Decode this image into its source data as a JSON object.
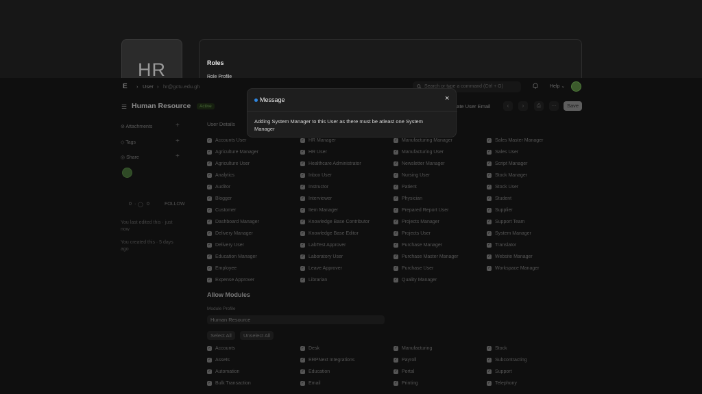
{
  "background_profile": {
    "initials": "HR",
    "section_title": "Roles",
    "section_sub": "Role Profile"
  },
  "topbar": {
    "logo": "E",
    "breadcrumb_user": "User",
    "breadcrumb_record": "hr@gctu.edu.gh",
    "search_placeholder": "Search or type a command (Ctrl + G)",
    "help": "Help"
  },
  "title_bar": {
    "title": "Human Resource",
    "status": "Active",
    "action_link": "eate User Email",
    "more": "···",
    "save": "Save"
  },
  "sidebar": {
    "attachments": "Attachments",
    "tags": "Tags",
    "share": "Share",
    "share_avatar": "HR",
    "likes": "0",
    "comments": "0",
    "follow": "FOLLOW",
    "last_edited": "You last edited this · just now",
    "created": "You created this · 5 days ago"
  },
  "main": {
    "user_details_label": "User Details",
    "roles": [
      [
        "Accounts User",
        "HR Manager",
        "Manufacturing Manager",
        "Sales Master Manager"
      ],
      [
        "Agriculture Manager",
        "HR User",
        "Manufacturing User",
        "Sales User"
      ],
      [
        "Agriculture User",
        "Healthcare Administrator",
        "Newsletter Manager",
        "Script Manager"
      ],
      [
        "Analytics",
        "Inbox User",
        "Nursing User",
        "Stock Manager"
      ],
      [
        "Auditor",
        "Instructor",
        "Patient",
        "Stock User"
      ],
      [
        "Blogger",
        "Interviewer",
        "Physician",
        "Student"
      ],
      [
        "Customer",
        "Item Manager",
        "Prepared Report User",
        "Supplier"
      ],
      [
        "Dashboard Manager",
        "Knowledge Base Contributor",
        "Projects Manager",
        "Support Team"
      ],
      [
        "Delivery Manager",
        "Knowledge Base Editor",
        "Projects User",
        "System Manager"
      ],
      [
        "Delivery User",
        "LabTest Approver",
        "Purchase Manager",
        "Translator"
      ],
      [
        "Education Manager",
        "Laboratory User",
        "Purchase Master Manager",
        "Website Manager"
      ],
      [
        "Employee",
        "Leave Approver",
        "Purchase User",
        "Workspace Manager"
      ],
      [
        "Expense Approver",
        "Librarian",
        "Quality Manager",
        ""
      ]
    ],
    "allow_modules_title": "Allow Modules",
    "module_profile_label": "Module Profile",
    "module_profile_value": "Human Resource",
    "select_all": "Select All",
    "unselect_all": "Unselect All",
    "modules": [
      [
        "Accounts",
        "Desk",
        "Manufacturing",
        "Stock"
      ],
      [
        "Assets",
        "ERPNext Integrations",
        "Payroll",
        "Subcontracting"
      ],
      [
        "Automation",
        "Education",
        "Portal",
        "Support"
      ],
      [
        "Bulk Transaction",
        "Email",
        "Printing",
        "Telephony"
      ]
    ]
  },
  "modal": {
    "title": "Message",
    "body": "Adding System Manager to this User as there must be atleast one System Manager",
    "close_icon": "×"
  },
  "colors": {
    "accent_dot": "#2f86e0",
    "background": "#0f0f0f",
    "modal_bg": "#1e1e1e"
  }
}
